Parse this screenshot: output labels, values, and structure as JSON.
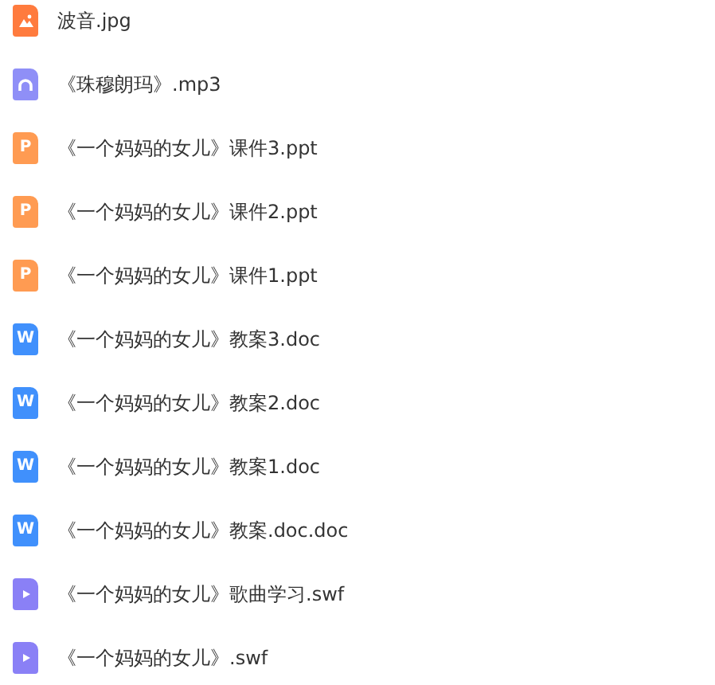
{
  "files": [
    {
      "kind": "image",
      "name": "波音.jpg"
    },
    {
      "kind": "audio",
      "name": "《珠穆朗玛》.mp3"
    },
    {
      "kind": "slides",
      "icon_label": "P",
      "name": "《一个妈妈的女儿》课件3.ppt"
    },
    {
      "kind": "slides",
      "icon_label": "P",
      "name": "《一个妈妈的女儿》课件2.ppt"
    },
    {
      "kind": "slides",
      "icon_label": "P",
      "name": "《一个妈妈的女儿》课件1.ppt"
    },
    {
      "kind": "document",
      "icon_label": "W",
      "name": "《一个妈妈的女儿》教案3.doc"
    },
    {
      "kind": "document",
      "icon_label": "W",
      "name": "《一个妈妈的女儿》教案2.doc"
    },
    {
      "kind": "document",
      "icon_label": "W",
      "name": "《一个妈妈的女儿》教案1.doc"
    },
    {
      "kind": "document",
      "icon_label": "W",
      "name": "《一个妈妈的女儿》教案.doc.doc"
    },
    {
      "kind": "video",
      "name": "《一个妈妈的女儿》歌曲学习.swf"
    },
    {
      "kind": "video",
      "name": "《一个妈妈的女儿》.swf"
    }
  ]
}
